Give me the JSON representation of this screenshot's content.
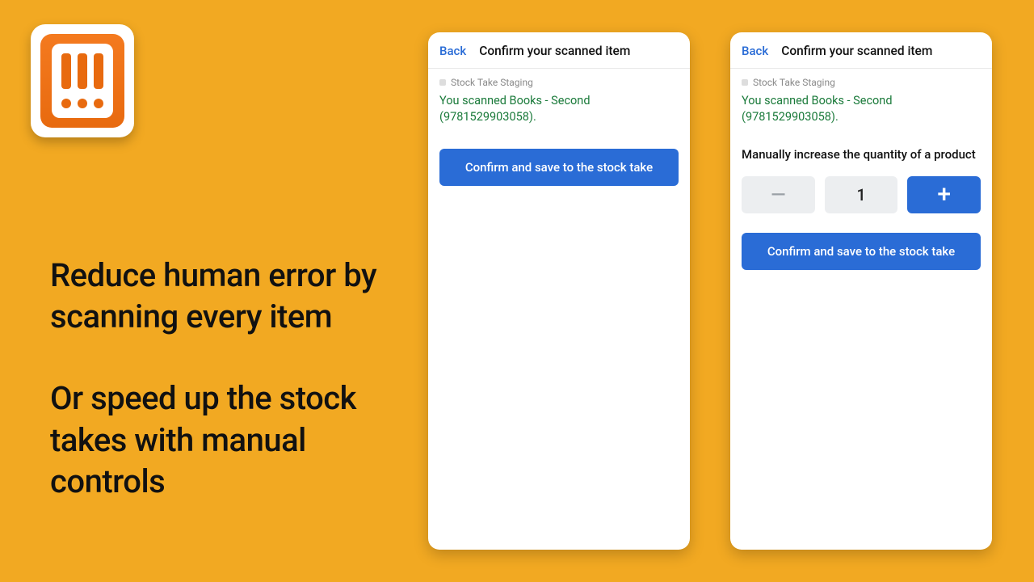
{
  "marketing": {
    "line1": "Reduce human error by scanning every item",
    "line2": "Or speed up the stock takes with manual controls"
  },
  "colors": {
    "bg": "#f2a922",
    "primary": "#2a6cd6",
    "success": "#1a7a3a",
    "iconOrange": "#e86a0f"
  },
  "screens": {
    "simple": {
      "back": "Back",
      "title": "Confirm your scanned item",
      "breadcrumb": "Stock Take Staging",
      "scanned": "You scanned Books - Second (9781529903058).",
      "confirm": "Confirm and save to the stock take"
    },
    "manual": {
      "back": "Back",
      "title": "Confirm your scanned item",
      "breadcrumb": "Stock Take Staging",
      "scanned": "You scanned Books - Second (9781529903058).",
      "manualLabel": "Manually increase the quantity of a product",
      "quantity": "1",
      "minus": "—",
      "plus": "+",
      "confirm": "Confirm and save to the stock take"
    }
  }
}
